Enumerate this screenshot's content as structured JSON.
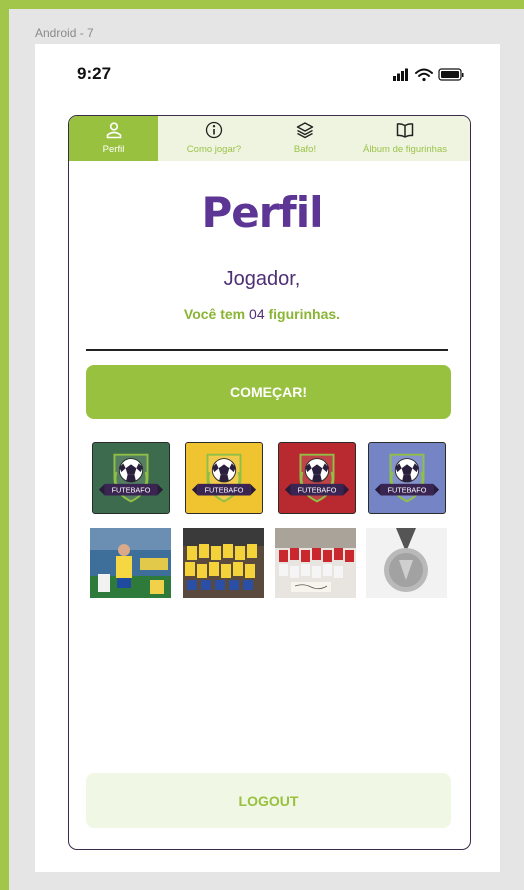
{
  "frame": {
    "label": "Android - 7"
  },
  "status_bar": {
    "time": "9:27",
    "icons": [
      "signal-icon",
      "wifi-icon",
      "battery-icon"
    ]
  },
  "tabs": [
    {
      "label": "Perfil",
      "icon": "person-icon",
      "active": true
    },
    {
      "label": "Como jogar?",
      "icon": "info-icon",
      "active": false
    },
    {
      "label": "Bafo!",
      "icon": "layers-icon",
      "active": false
    },
    {
      "label": "Álbum de figurinhas",
      "icon": "book-icon",
      "active": false
    }
  ],
  "profile": {
    "title": "Perfil",
    "player": "Jogador,",
    "count_prefix": "Você tem",
    "count": "04",
    "count_suffix": "figurinhas."
  },
  "start_label": "COMEÇAR!",
  "badges": [
    {
      "text": "FUTEBAFO",
      "color": "#3d6b4d"
    },
    {
      "text": "FUTEBAFO",
      "color": "#f0c430"
    },
    {
      "text": "FUTEBAFO",
      "color": "#b82a2f"
    },
    {
      "text": "FUTEBAFO",
      "color": "#7484c4"
    }
  ],
  "stickers": [
    "player-photo",
    "team-photo",
    "team-photo-2",
    "medal-photo"
  ],
  "logout_label": "LOGOUT",
  "colors": {
    "accent": "#97c13e",
    "brand": "#5c3595",
    "frame": "#a1c64a"
  }
}
